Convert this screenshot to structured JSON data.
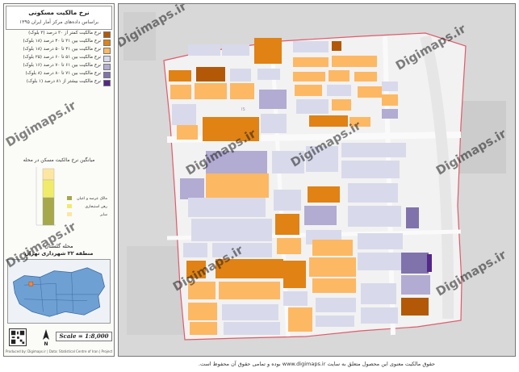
{
  "sidebar": {
    "title": "نرخ مالکیت مسکونی",
    "subtitle": "براساس داده‌های مرکز آمار ایران ۱۳۹۵",
    "legend": [
      {
        "label": "نرخ مالکیت کمتر از ۳۰ درصد (۳ بلوک)",
        "color": "#b35806"
      },
      {
        "label": "نرخ مالکیت بین ۳۱ تا ۴۰ درصد (۱۸ بلوک)",
        "color": "#e08214"
      },
      {
        "label": "نرخ مالکیت بین ۴۱ تا ۵۰ درصد (۱۸ بلوک)",
        "color": "#fdb863"
      },
      {
        "label": "نرخ مالکیت بین ۵۱ تا ۶۰ درصد (۲۵ بلوک)",
        "color": "#d8daeb"
      },
      {
        "label": "نرخ مالکیت بین ۶۱ تا ۷۰ درصد (۱۶ بلوک)",
        "color": "#b2abd2"
      },
      {
        "label": "نرخ مالکیت بین ۷۱ تا ۸۰ درصد (۸ بلوک)",
        "color": "#8073ac"
      },
      {
        "label": "نرخ مالکیت بیشتر از ۸۱ درصد (۱ بلوک)",
        "color": "#542788"
      }
    ],
    "chart": {
      "title": "میانگین نرخ مالکیت مسکن در محله",
      "labels": [
        "مالک عرصه و اعیان",
        "رهن استیجاری",
        "سایر"
      ],
      "colors": [
        "#a6a84a",
        "#f0ec6a",
        "#fde6a0"
      ]
    },
    "minimap_title": "محله گلستان",
    "minimap_subtitle": "منطقه ۲۲ شهرداری تهران",
    "north_label": "N",
    "scale_text": "Scale = 1:8,000",
    "credit": "Produced by: Digimaps.ir  |  Data: Statistical Centre of Iran  |  Projection: UTM"
  },
  "map": {
    "watermark": "Digimaps.ir",
    "block_label": "IS",
    "colors": {
      "background": "#dcdcdc",
      "road": "#f4f4f4",
      "boundary": "#e05a6a"
    }
  },
  "footer": "حقوق مالکیت معنوی این محصول متعلق به سایت www.digimaps.ir بوده و تمامی حقوق آن محفوظ است."
}
